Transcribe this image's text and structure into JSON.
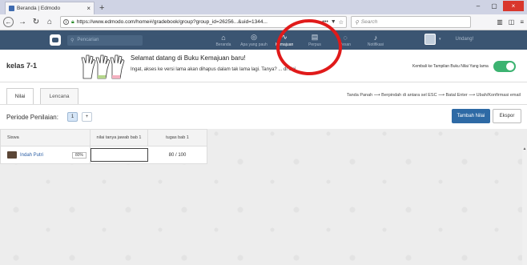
{
  "browser": {
    "tab_title": "Beranda | Edmodo",
    "tab_close": "×",
    "new_tab": "+",
    "url": "https://www.edmodo.com/home#/gradebook/group?group_id=26256...&uid=1344...",
    "search_placeholder": "Search",
    "window_controls": [
      "–",
      "▢",
      "×"
    ]
  },
  "appbar": {
    "search_placeholder": "Pencarian",
    "nav": [
      {
        "label": "Beranda",
        "icon": "home-icon",
        "glyph": "⌂"
      },
      {
        "label": "Apa yang pauh",
        "icon": "discover-icon",
        "glyph": "◎"
      },
      {
        "label": "Kemajuan",
        "icon": "progress-icon",
        "glyph": "∿"
      },
      {
        "label": "Perpus",
        "icon": "library-icon",
        "glyph": "▤"
      },
      {
        "label": "Pesan",
        "icon": "message-icon",
        "glyph": "◌"
      },
      {
        "label": "Notifikasi",
        "icon": "bell-icon",
        "glyph": "♪"
      }
    ],
    "username": "Undang!"
  },
  "banner": {
    "class_name": "kelas 7-1",
    "title": "Selamat datang di Buku Kemajuan baru!",
    "text": "Ingat, akses ke versi lama akan dihapus dalam tak lama lagi. Tanya? ... di sini.",
    "toggle_label": "Kembali ke Tampilan Buku Nilai Yang lama",
    "toggle_on": true
  },
  "tabs": [
    "Nilai",
    "Lencana"
  ],
  "shortcuts": "Tanda Panah ⟶ Berpindah di antara sel   ESC ⟶ Batal   Enter ⟶ Ubah/Konfirmasi email",
  "period": {
    "label": "Periode Penilaian:",
    "current": "1",
    "add": "+"
  },
  "actions": {
    "add_grade": "Tambah Nilai",
    "export": "Ekspor"
  },
  "gradebook": {
    "student_header": "Siswa",
    "columns": [
      "nilai tanya jawab bab 1",
      "tugas bab 1"
    ],
    "rows": [
      {
        "name": "Indah Putri",
        "percent": "80%",
        "scores": [
          "",
          "80 / 100"
        ]
      }
    ]
  },
  "colors": {
    "appbar": "#3b5572",
    "accent": "#2e6aa5",
    "toggle": "#3cb371",
    "annotation": "#e01a1a"
  }
}
